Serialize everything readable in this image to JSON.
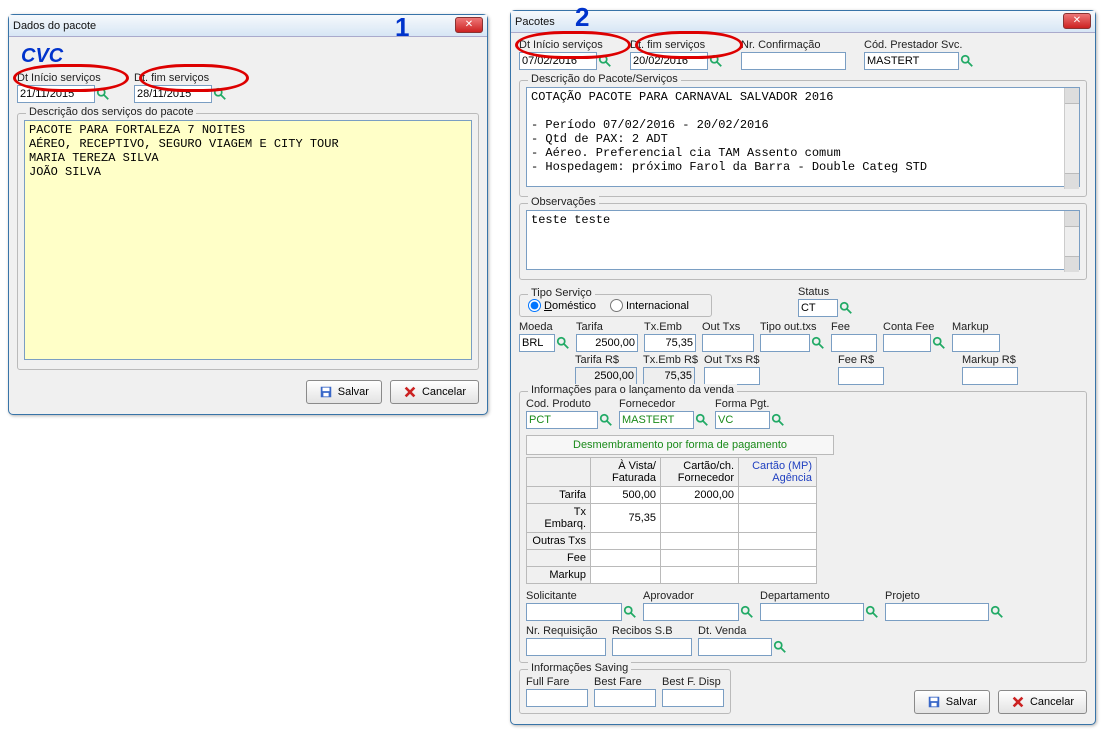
{
  "annotations": {
    "num1": "1",
    "num2": "2"
  },
  "win1": {
    "title": "Dados do pacote",
    "brand": "CVC",
    "dt_inicio_lbl": "Dt Início serviços",
    "dt_inicio": "21/11/2015",
    "dt_fim_lbl": "Dt. fim serviços",
    "dt_fim": "28/11/2015",
    "desc_lbl": "Descrição dos serviços do pacote",
    "desc": "PACOTE PARA FORTALEZA 7 NOITES\nAÉREO, RECEPTIVO, SEGURO VIAGEM E CITY TOUR\nMARIA TEREZA SILVA\nJOÃO SILVA",
    "save": "Salvar",
    "cancel": "Cancelar"
  },
  "win2": {
    "title": "Pacotes",
    "dt_inicio_lbl": "Dt Início serviços",
    "dt_inicio": "07/02/2016",
    "dt_fim_lbl": "Dt. fim serviços",
    "dt_fim": "20/02/2016",
    "nr_conf_lbl": "Nr. Confirmação",
    "nr_conf": "",
    "cod_prest_lbl": "Cód. Prestador Svc.",
    "cod_prest": "MASTERT",
    "desc_lbl": "Descrição do Pacote/Serviços",
    "desc": "COTAÇÃO PACOTE PARA CARNAVAL SALVADOR 2016\n\n- Período 07/02/2016 - 20/02/2016\n- Qtd de PAX: 2 ADT\n- Aéreo. Preferencial cia TAM Assento comum\n- Hospedagem: próximo Farol da Barra - Double Categ STD",
    "obs_lbl": "Observações",
    "obs": "teste teste",
    "tipo_lbl": "Tipo Serviço",
    "tipo_dom_pre": "D",
    "tipo_dom": "oméstico",
    "tipo_int": "Internacional",
    "status_lbl": "Status",
    "status": "CT",
    "moeda_lbl": "Moeda",
    "moeda": "BRL",
    "tarifa_lbl": "Tarifa",
    "tarifa": "2500,00",
    "txemb_lbl": "Tx.Emb",
    "txemb": "75,35",
    "outtxs_lbl": "Out Txs",
    "outtxs": "",
    "tipoout_lbl": "Tipo out.txs",
    "tipoout": "",
    "fee_lbl": "Fee",
    "fee": "",
    "contafee_lbl": "Conta Fee",
    "contafee": "",
    "markup_lbl": "Markup",
    "markup": "",
    "tarifars_lbl": "Tarifa R$",
    "tarifars": "2500,00",
    "txembrs_lbl": "Tx.Emb R$",
    "txembrs": "75,35",
    "outtxsrs_lbl": "Out Txs R$",
    "outtxsrs": "",
    "feers_lbl": "Fee R$",
    "feers": "",
    "markuprs_lbl": "Markup R$",
    "markuprs": "",
    "info_venda_lbl": "Informações para o lançamento da venda",
    "codprod_lbl": "Cod. Produto",
    "codprod": "PCT",
    "forn_lbl": "Fornecedor",
    "forn": "MASTERT",
    "formapgt_lbl": "Forma Pgt.",
    "formapgt": "VC",
    "pay_title": "Desmembramento por forma de pagamento",
    "pay_h1": "À Vista/ Faturada",
    "pay_h2": "Cartão/ch. Fornecedor",
    "pay_h3": "Cartão (MP) Agência",
    "pay_r1": "Tarifa",
    "pay_r1c1": "500,00",
    "pay_r1c2": "2000,00",
    "pay_r1c3": "",
    "pay_r2": "Tx Embarq.",
    "pay_r2c1": "75,35",
    "pay_r2c2": "",
    "pay_r2c3": "",
    "pay_r3": "Outras Txs",
    "pay_r3c1": "",
    "pay_r3c2": "",
    "pay_r3c3": "",
    "pay_r4": "Fee",
    "pay_r4c1": "",
    "pay_r4c2": "",
    "pay_r4c3": "",
    "pay_r5": "Markup",
    "pay_r5c1": "",
    "pay_r5c2": "",
    "pay_r5c3": "",
    "solic_lbl": "Solicitante",
    "aprov_lbl": "Aprovador",
    "depto_lbl": "Departamento",
    "proj_lbl": "Projeto",
    "nrreq_lbl": "Nr. Requisição",
    "recibos_lbl": "Recibos S.B",
    "dtvenda_lbl": "Dt. Venda",
    "saving_lbl": "Informações Saving",
    "fullfare_lbl": "Full Fare",
    "bestfare_lbl": "Best Fare",
    "bestfdisp_lbl": "Best F. Disp",
    "save": "Salvar",
    "cancel": "Cancelar"
  }
}
